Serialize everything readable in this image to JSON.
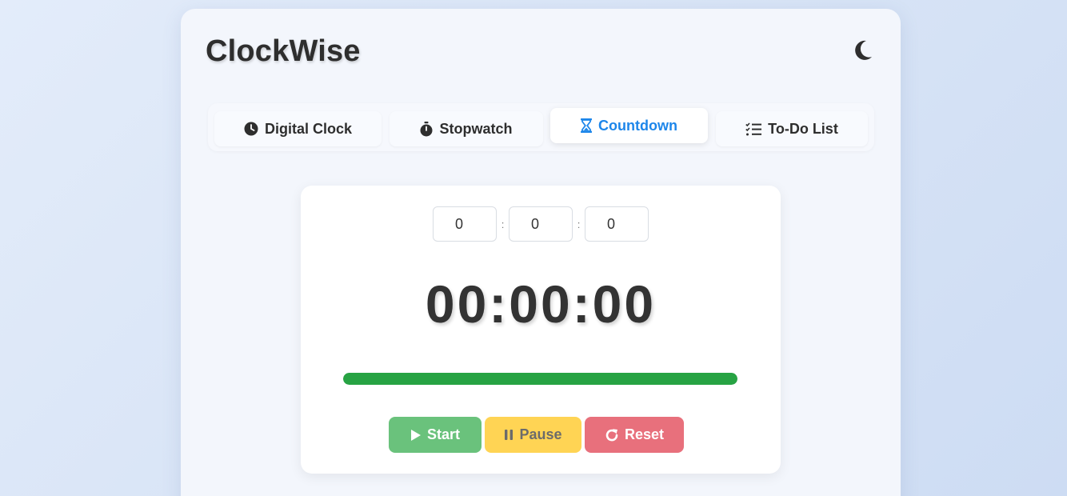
{
  "app": {
    "title": "ClockWise"
  },
  "header": {
    "theme_toggle_icon": "moon-icon"
  },
  "tabs": [
    {
      "label": "Digital Clock",
      "icon": "clock-icon",
      "active": false
    },
    {
      "label": "Stopwatch",
      "icon": "stopwatch-icon",
      "active": false
    },
    {
      "label": "Countdown",
      "icon": "hourglass-icon",
      "active": true
    },
    {
      "label": "To-Do List",
      "icon": "checklist-icon",
      "active": false
    }
  ],
  "countdown": {
    "hours_value": "0",
    "minutes_value": "0",
    "seconds_value": "0",
    "separator": ":",
    "display": "00:00:00",
    "progress_percent": 100
  },
  "controls": {
    "start_label": "Start",
    "pause_label": "Pause",
    "reset_label": "Reset"
  },
  "colors": {
    "accent": "#1d86ea",
    "progress": "#27a343",
    "start": "#6ac27c",
    "pause": "#ffd454",
    "reset": "#e8707c"
  }
}
